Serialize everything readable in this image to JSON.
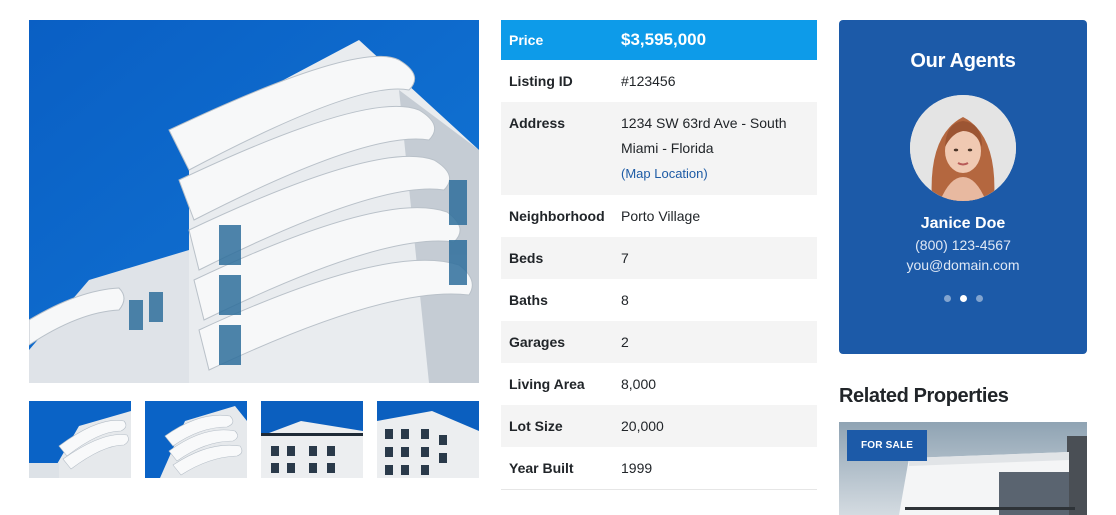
{
  "gallery": {
    "main_image": "apartment-building-photo",
    "thumbnails": [
      "building-thumb-1",
      "building-thumb-2",
      "building-thumb-3",
      "building-thumb-4"
    ]
  },
  "details": {
    "price_label": "Price",
    "price_value": "$3,595,000",
    "rows": [
      {
        "label": "Listing ID",
        "value": "#123456"
      },
      {
        "label": "Address",
        "value": "1234 SW 63rd Ave - South Miami - Florida",
        "link": "(Map Location)"
      },
      {
        "label": "Neighborhood",
        "value": "Porto Village"
      },
      {
        "label": "Beds",
        "value": "7"
      },
      {
        "label": "Baths",
        "value": "8"
      },
      {
        "label": "Garages",
        "value": "2"
      },
      {
        "label": "Living Area",
        "value": "8,000"
      },
      {
        "label": "Lot Size",
        "value": "20,000"
      },
      {
        "label": "Year Built",
        "value": "1999"
      }
    ]
  },
  "agents": {
    "title": "Our Agents",
    "name": "Janice Doe",
    "phone": "(800) 123-4567",
    "email": "you@domain.com",
    "carousel_dots": 3,
    "active_dot": 2
  },
  "related": {
    "title": "Related Properties",
    "badge": "FOR SALE"
  },
  "colors": {
    "price_bar": "#0d9be9",
    "agent_card": "#1c5aa8",
    "link": "#1d5ba5",
    "sky": "#0a66c8"
  }
}
